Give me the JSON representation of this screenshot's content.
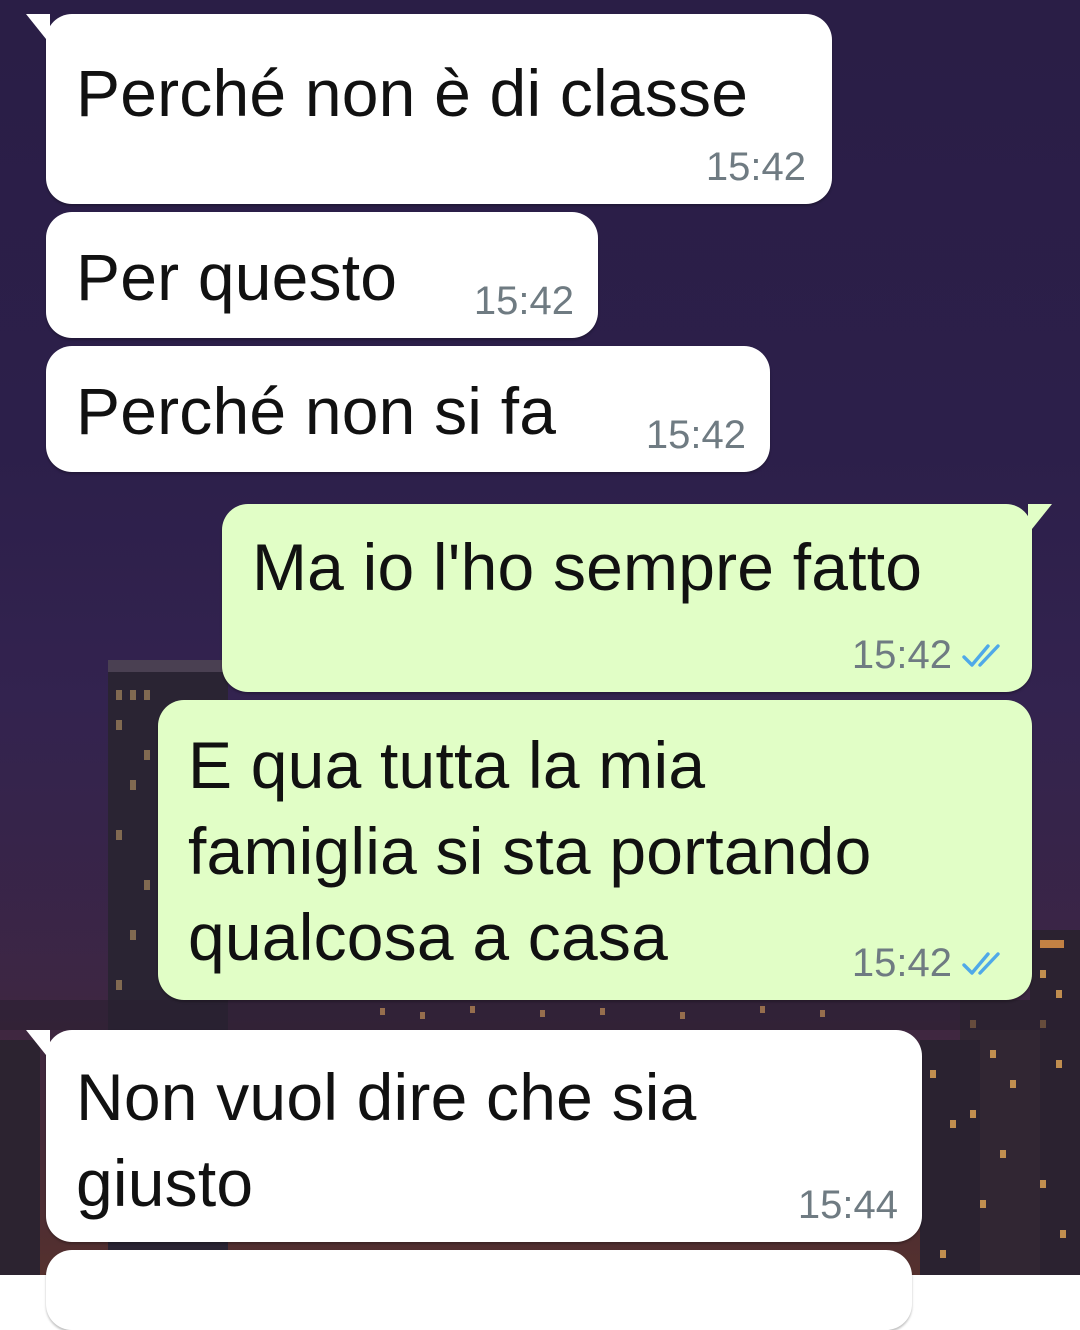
{
  "conversation": {
    "messages": [
      {
        "direction": "incoming",
        "text": "Perché non è di classe",
        "time": "15:42"
      },
      {
        "direction": "incoming",
        "text": "Per questo",
        "time": "15:42"
      },
      {
        "direction": "incoming",
        "text": "Perché non si fa",
        "time": "15:42"
      },
      {
        "direction": "outgoing",
        "text": "Ma io l'ho sempre fatto",
        "time": "15:42",
        "status": "read-double-check"
      },
      {
        "direction": "outgoing",
        "text": "E qua tutta la mia\nfamiglia si sta portando\nqualcosa a casa",
        "time": "15:42",
        "status": "read-double-check"
      },
      {
        "direction": "incoming",
        "text": "Non vuol dire che sia\ngiusto",
        "time": "15:44"
      },
      {
        "direction": "incoming",
        "text": "",
        "time": ""
      }
    ]
  },
  "theme": {
    "incoming_bubble": "#ffffff",
    "outgoing_bubble": "#e1fec6",
    "timestamp_color": "#6f7b82",
    "read_tick_color": "#4fa9e8",
    "wallpaper": "night-city-skyline"
  }
}
